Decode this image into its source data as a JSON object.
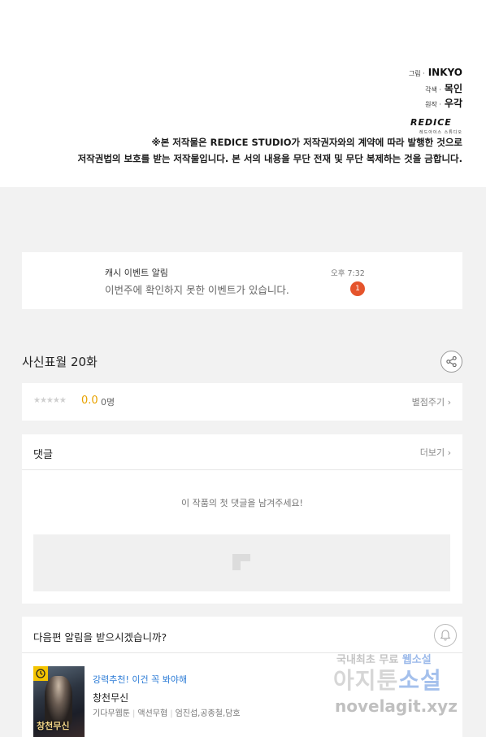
{
  "credits": {
    "art_role": "그림 ·",
    "art_name": "INKYO",
    "adapt_role": "각색 ·",
    "adapt_name": "목인",
    "original_role": "원작 ·",
    "original_name": "우각",
    "logo_text": "REDICE",
    "logo_sub": "레드아이스 스튜디오",
    "copyright_line1": "※본 저작물은 REDICE STUDIO가 저작권자와의 계약에 따라 발행한 것으로",
    "copyright_line2": "저작권법의 보호를 받는 저작물입니다. 본 서의 내용을 무단 전재 및 무단 복제하는 것을 금합니다."
  },
  "notification": {
    "title": "캐시 이벤트 알림",
    "body": "이번주에 확인하지 못한 이벤트가 있습니다.",
    "time": "오후 7:32",
    "badge_count": "1",
    "badge_color": "#e5542c"
  },
  "episode": {
    "title": "사신표월 20화",
    "share_icon": "share-icon"
  },
  "rating": {
    "stars": "★★★★★",
    "score": "0.0",
    "count": "0명",
    "rate_link": "별점주기 ›",
    "score_color": "#e8a200"
  },
  "comments": {
    "title": "댓글",
    "more_link": "더보기 ›",
    "empty_text": "이 작품의 첫 댓글을 남겨주세요!"
  },
  "subscribe": {
    "question": "다음편 알림을 받으시겠습니까?",
    "bell_icon": "bell-icon"
  },
  "recommendation": {
    "label": "강력추천! 이건 꼭 봐야해",
    "title": "창천무신",
    "tag1": "기다무웹툰",
    "tag2": "액션무협",
    "tag3": "엄진섭,공종철,담호",
    "thumb_title": "창천무신",
    "label_color": "#2b7bd6"
  },
  "watermark": {
    "line1_a": "국내최초 무료",
    "line1_b": "웹소설",
    "line2_a": "아지툰",
    "line2_b": "소설",
    "line3": "novelagit.xyz"
  }
}
